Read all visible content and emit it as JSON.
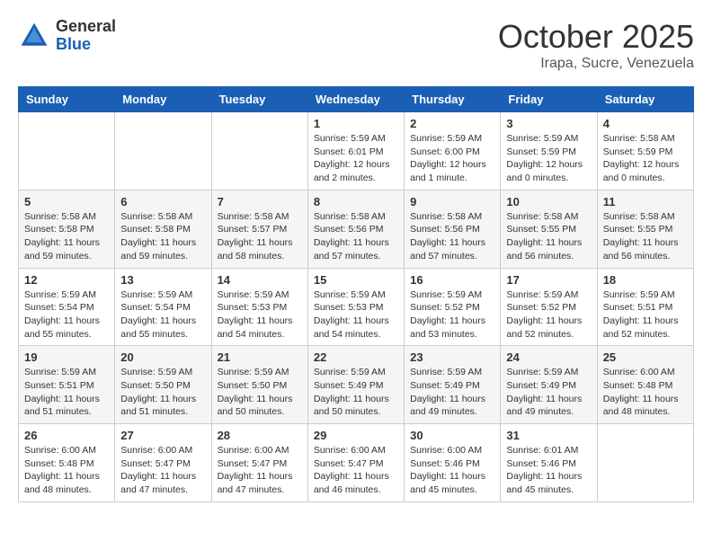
{
  "header": {
    "logo_general": "General",
    "logo_blue": "Blue",
    "month": "October 2025",
    "location": "Irapa, Sucre, Venezuela"
  },
  "weekdays": [
    "Sunday",
    "Monday",
    "Tuesday",
    "Wednesday",
    "Thursday",
    "Friday",
    "Saturday"
  ],
  "weeks": [
    [
      {
        "day": "",
        "info": ""
      },
      {
        "day": "",
        "info": ""
      },
      {
        "day": "",
        "info": ""
      },
      {
        "day": "1",
        "info": "Sunrise: 5:59 AM\nSunset: 6:01 PM\nDaylight: 12 hours\nand 2 minutes."
      },
      {
        "day": "2",
        "info": "Sunrise: 5:59 AM\nSunset: 6:00 PM\nDaylight: 12 hours\nand 1 minute."
      },
      {
        "day": "3",
        "info": "Sunrise: 5:59 AM\nSunset: 5:59 PM\nDaylight: 12 hours\nand 0 minutes."
      },
      {
        "day": "4",
        "info": "Sunrise: 5:58 AM\nSunset: 5:59 PM\nDaylight: 12 hours\nand 0 minutes."
      }
    ],
    [
      {
        "day": "5",
        "info": "Sunrise: 5:58 AM\nSunset: 5:58 PM\nDaylight: 11 hours\nand 59 minutes."
      },
      {
        "day": "6",
        "info": "Sunrise: 5:58 AM\nSunset: 5:58 PM\nDaylight: 11 hours\nand 59 minutes."
      },
      {
        "day": "7",
        "info": "Sunrise: 5:58 AM\nSunset: 5:57 PM\nDaylight: 11 hours\nand 58 minutes."
      },
      {
        "day": "8",
        "info": "Sunrise: 5:58 AM\nSunset: 5:56 PM\nDaylight: 11 hours\nand 57 minutes."
      },
      {
        "day": "9",
        "info": "Sunrise: 5:58 AM\nSunset: 5:56 PM\nDaylight: 11 hours\nand 57 minutes."
      },
      {
        "day": "10",
        "info": "Sunrise: 5:58 AM\nSunset: 5:55 PM\nDaylight: 11 hours\nand 56 minutes."
      },
      {
        "day": "11",
        "info": "Sunrise: 5:58 AM\nSunset: 5:55 PM\nDaylight: 11 hours\nand 56 minutes."
      }
    ],
    [
      {
        "day": "12",
        "info": "Sunrise: 5:59 AM\nSunset: 5:54 PM\nDaylight: 11 hours\nand 55 minutes."
      },
      {
        "day": "13",
        "info": "Sunrise: 5:59 AM\nSunset: 5:54 PM\nDaylight: 11 hours\nand 55 minutes."
      },
      {
        "day": "14",
        "info": "Sunrise: 5:59 AM\nSunset: 5:53 PM\nDaylight: 11 hours\nand 54 minutes."
      },
      {
        "day": "15",
        "info": "Sunrise: 5:59 AM\nSunset: 5:53 PM\nDaylight: 11 hours\nand 54 minutes."
      },
      {
        "day": "16",
        "info": "Sunrise: 5:59 AM\nSunset: 5:52 PM\nDaylight: 11 hours\nand 53 minutes."
      },
      {
        "day": "17",
        "info": "Sunrise: 5:59 AM\nSunset: 5:52 PM\nDaylight: 11 hours\nand 52 minutes."
      },
      {
        "day": "18",
        "info": "Sunrise: 5:59 AM\nSunset: 5:51 PM\nDaylight: 11 hours\nand 52 minutes."
      }
    ],
    [
      {
        "day": "19",
        "info": "Sunrise: 5:59 AM\nSunset: 5:51 PM\nDaylight: 11 hours\nand 51 minutes."
      },
      {
        "day": "20",
        "info": "Sunrise: 5:59 AM\nSunset: 5:50 PM\nDaylight: 11 hours\nand 51 minutes."
      },
      {
        "day": "21",
        "info": "Sunrise: 5:59 AM\nSunset: 5:50 PM\nDaylight: 11 hours\nand 50 minutes."
      },
      {
        "day": "22",
        "info": "Sunrise: 5:59 AM\nSunset: 5:49 PM\nDaylight: 11 hours\nand 50 minutes."
      },
      {
        "day": "23",
        "info": "Sunrise: 5:59 AM\nSunset: 5:49 PM\nDaylight: 11 hours\nand 49 minutes."
      },
      {
        "day": "24",
        "info": "Sunrise: 5:59 AM\nSunset: 5:49 PM\nDaylight: 11 hours\nand 49 minutes."
      },
      {
        "day": "25",
        "info": "Sunrise: 6:00 AM\nSunset: 5:48 PM\nDaylight: 11 hours\nand 48 minutes."
      }
    ],
    [
      {
        "day": "26",
        "info": "Sunrise: 6:00 AM\nSunset: 5:48 PM\nDaylight: 11 hours\nand 48 minutes."
      },
      {
        "day": "27",
        "info": "Sunrise: 6:00 AM\nSunset: 5:47 PM\nDaylight: 11 hours\nand 47 minutes."
      },
      {
        "day": "28",
        "info": "Sunrise: 6:00 AM\nSunset: 5:47 PM\nDaylight: 11 hours\nand 47 minutes."
      },
      {
        "day": "29",
        "info": "Sunrise: 6:00 AM\nSunset: 5:47 PM\nDaylight: 11 hours\nand 46 minutes."
      },
      {
        "day": "30",
        "info": "Sunrise: 6:00 AM\nSunset: 5:46 PM\nDaylight: 11 hours\nand 45 minutes."
      },
      {
        "day": "31",
        "info": "Sunrise: 6:01 AM\nSunset: 5:46 PM\nDaylight: 11 hours\nand 45 minutes."
      },
      {
        "day": "",
        "info": ""
      }
    ]
  ]
}
